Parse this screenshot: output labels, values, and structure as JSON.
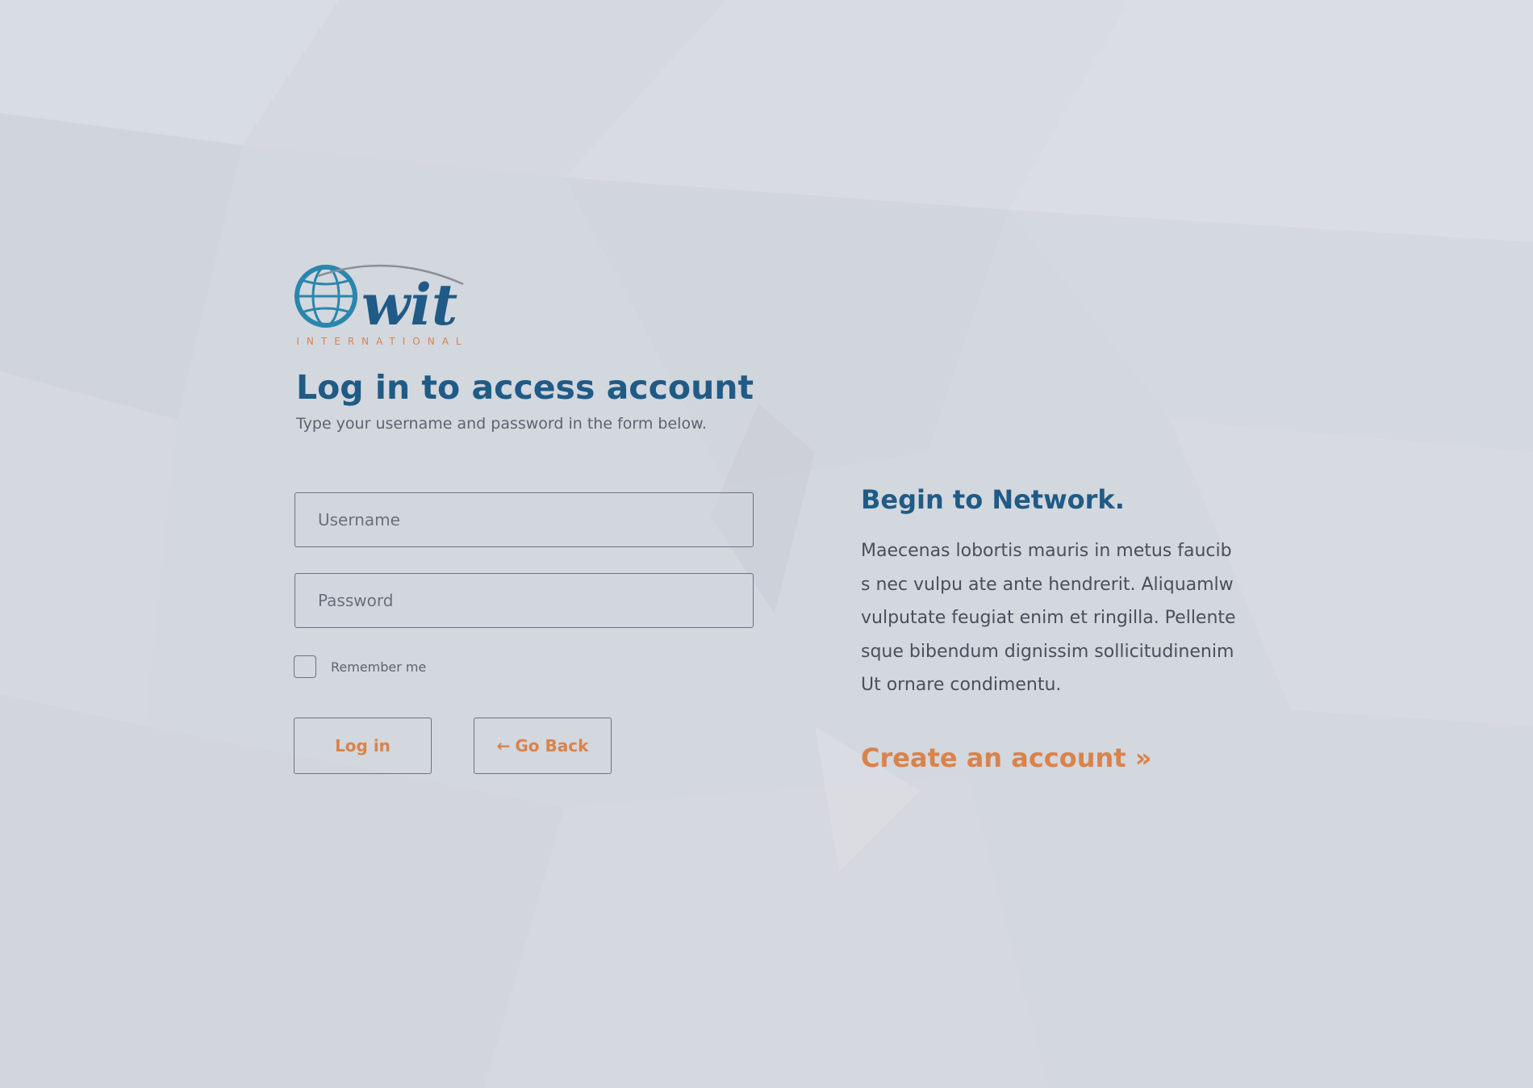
{
  "logo": {
    "wordmark": "wit",
    "subtitle": "INTERNATIONAL"
  },
  "login": {
    "title": "Log in to access account",
    "subtitle": "Type your username and password in the form below.",
    "username_placeholder": "Username",
    "password_placeholder": "Password",
    "username_value": "",
    "password_value": "",
    "remember_label": "Remember me",
    "remember_checked": false,
    "login_button": "Log in",
    "back_arrow": "←",
    "back_button": "Go Back"
  },
  "network": {
    "title": "Begin to Network.",
    "body_lines": [
      "Maecenas lobortis mauris in metus faucib",
      "s nec vulpu ate ante hendrerit. Aliquamlw",
      "vulputate feugiat enim et ringilla. Pellente",
      "sque bibendum dignissim sollicitudinenim",
      "Ut ornare condimentu."
    ],
    "create_link": "Create an account »"
  },
  "colors": {
    "background": "#d3d7de",
    "heading_blue": "#1f5b86",
    "accent_orange": "#d9834b",
    "body_text": "#4a4f59",
    "border": "#6c7280"
  },
  "icons": {
    "logo_globe": "globe-icon",
    "back_arrow": "arrow-left-icon"
  }
}
